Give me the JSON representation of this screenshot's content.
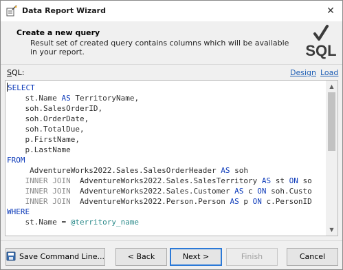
{
  "window": {
    "title": "Data Report Wizard",
    "close_glyph": "✕",
    "icon": "wizard-icon"
  },
  "header": {
    "title": "Create a new query",
    "description": "Result set of created query contains columns which will be available in your report.",
    "logo_text": "SQL",
    "logo_icon": "sql-check-icon"
  },
  "editor": {
    "label_prefix": "",
    "label_mnemonic": "S",
    "label_rest": "QL:",
    "design_link": "Design",
    "load_link": "Load",
    "lines": [
      [
        {
          "t": "SELECT",
          "c": "kw"
        }
      ],
      [
        {
          "t": "    st.Name ",
          "c": "id"
        },
        {
          "t": "AS",
          "c": "kw"
        },
        {
          "t": " TerritoryName,",
          "c": "id"
        }
      ],
      [
        {
          "t": "    soh.SalesOrderID,",
          "c": "id"
        }
      ],
      [
        {
          "t": "    soh.OrderDate,",
          "c": "id"
        }
      ],
      [
        {
          "t": "    soh.TotalDue,",
          "c": "id"
        }
      ],
      [
        {
          "t": "    p.FirstName,",
          "c": "id"
        }
      ],
      [
        {
          "t": "    p.LastName",
          "c": "id"
        }
      ],
      [
        {
          "t": "FROM",
          "c": "kw"
        }
      ],
      [
        {
          "t": "     AdventureWorks2022.Sales.SalesOrderHeader ",
          "c": "id"
        },
        {
          "t": "AS",
          "c": "kw"
        },
        {
          "t": " soh",
          "c": "id"
        }
      ],
      [
        {
          "t": "    ",
          "c": "id"
        },
        {
          "t": "INNER JOIN",
          "c": "kw-gray"
        },
        {
          "t": "  AdventureWorks2022.Sales.SalesTerritory ",
          "c": "id"
        },
        {
          "t": "AS",
          "c": "kw"
        },
        {
          "t": " st ",
          "c": "id"
        },
        {
          "t": "ON",
          "c": "kw"
        },
        {
          "t": " so",
          "c": "id"
        }
      ],
      [
        {
          "t": "    ",
          "c": "id"
        },
        {
          "t": "INNER JOIN",
          "c": "kw-gray"
        },
        {
          "t": "  AdventureWorks2022.Sales.Customer ",
          "c": "id"
        },
        {
          "t": "AS",
          "c": "kw"
        },
        {
          "t": " c ",
          "c": "id"
        },
        {
          "t": "ON",
          "c": "kw"
        },
        {
          "t": " soh.Custo",
          "c": "id"
        }
      ],
      [
        {
          "t": "    ",
          "c": "id"
        },
        {
          "t": "INNER JOIN",
          "c": "kw-gray"
        },
        {
          "t": "  AdventureWorks2022.Person.Person ",
          "c": "id"
        },
        {
          "t": "AS",
          "c": "kw"
        },
        {
          "t": " p ",
          "c": "id"
        },
        {
          "t": "ON",
          "c": "kw"
        },
        {
          "t": " c.PersonID",
          "c": "id"
        }
      ],
      [
        {
          "t": "WHERE",
          "c": "kw"
        }
      ],
      [
        {
          "t": "    st.Name = ",
          "c": "id"
        },
        {
          "t": "@territory_name",
          "c": "var"
        }
      ]
    ]
  },
  "buttons": {
    "save_command_line": "Save Command Line...",
    "back": "< Back",
    "next": "Next >",
    "finish": "Finish",
    "cancel": "Cancel"
  },
  "colors": {
    "keyword": "#0c3ab9",
    "join_keyword": "#8a8a8a",
    "variable": "#2a8a8a",
    "link": "#1f5fb5",
    "focus": "#2b79d7"
  }
}
